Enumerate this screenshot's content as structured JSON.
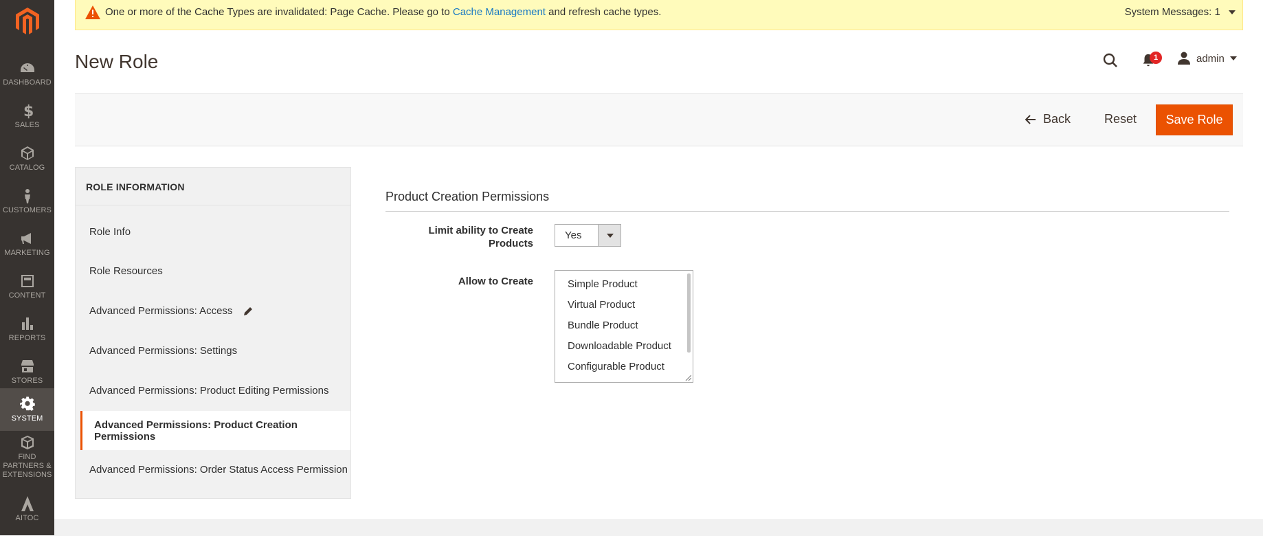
{
  "sidebar": {
    "items": [
      {
        "label": "DASHBOARD",
        "icon": "dashboard-icon"
      },
      {
        "label": "SALES",
        "icon": "dollar-icon"
      },
      {
        "label": "CATALOG",
        "icon": "cube-icon"
      },
      {
        "label": "CUSTOMERS",
        "icon": "person-icon"
      },
      {
        "label": "MARKETING",
        "icon": "megaphone-icon"
      },
      {
        "label": "CONTENT",
        "icon": "content-icon"
      },
      {
        "label": "REPORTS",
        "icon": "bar-chart-icon"
      },
      {
        "label": "STORES",
        "icon": "store-icon"
      },
      {
        "label": "SYSTEM",
        "icon": "gear-icon"
      },
      {
        "label": "FIND PARTNERS & EXTENSIONS",
        "icon": "box-icon"
      },
      {
        "label": "AITOC",
        "icon": "aitoc-icon"
      }
    ],
    "active": "SYSTEM"
  },
  "system_message": {
    "text_before": "One or more of the Cache Types are invalidated: Page Cache. Please go to ",
    "link": "Cache Management",
    "text_after": " and refresh cache types.",
    "right": "System Messages: 1"
  },
  "header": {
    "title": "New Role",
    "notification_count": "1",
    "user": "admin"
  },
  "actions": {
    "back": "Back",
    "reset": "Reset",
    "save": "Save Role"
  },
  "tabs": {
    "title": "ROLE INFORMATION",
    "items": [
      "Role Info",
      "Role Resources",
      "Advanced Permissions: Access",
      "Advanced Permissions: Settings",
      "Advanced Permissions: Product Editing Permissions",
      "Advanced Permissions: Product Creation Permissions",
      "Advanced Permissions: Order Status Access Permission"
    ],
    "active_index": 5
  },
  "form": {
    "section_title": "Product Creation Permissions",
    "limit_label": "Limit ability to Create Products",
    "limit_value": "Yes",
    "allow_label": "Allow to Create",
    "allow_options": [
      "Simple Product",
      "Virtual Product",
      "Bundle Product",
      "Downloadable Product",
      "Configurable Product"
    ]
  },
  "colors": {
    "sidebar_bg": "#373330",
    "accent": "#eb5202",
    "link": "#1979c3",
    "message_bg": "#fffbbb"
  }
}
